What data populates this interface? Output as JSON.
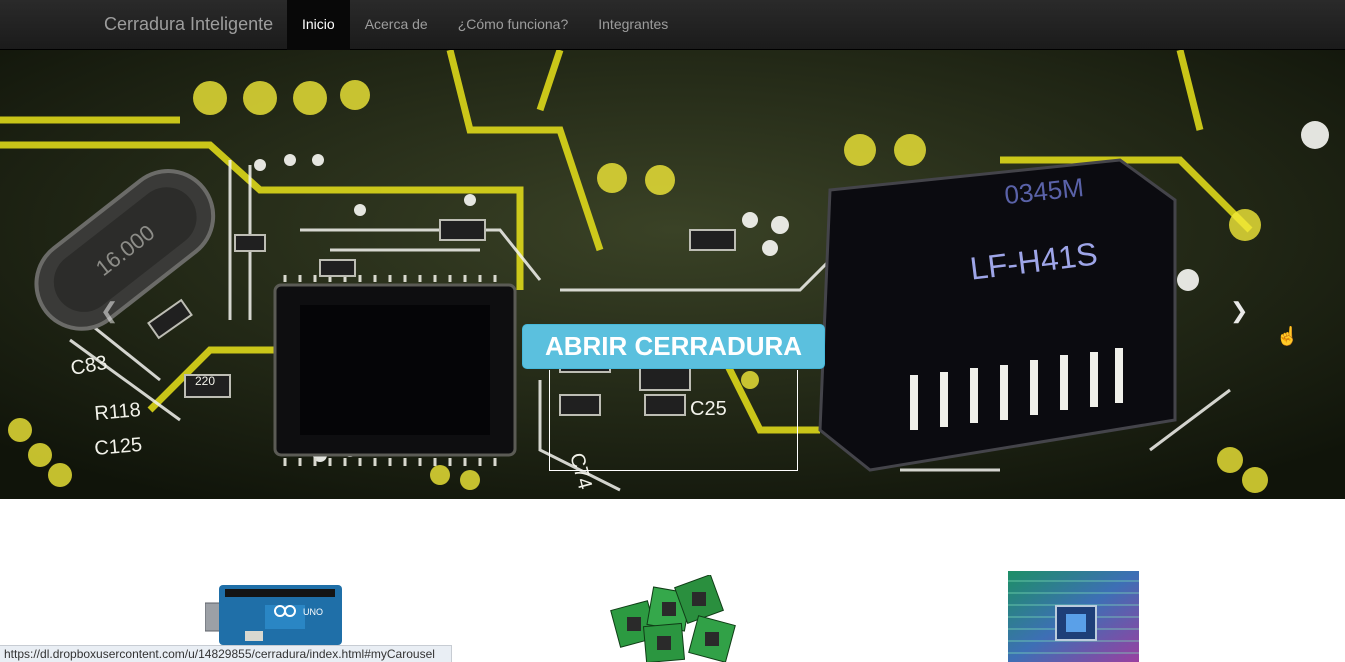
{
  "navbar": {
    "brand": "Cerradura Inteligente",
    "items": [
      {
        "label": "Inicio",
        "active": true
      },
      {
        "label": "Acerca de",
        "active": false
      },
      {
        "label": "¿Cómo funciona?",
        "active": false
      },
      {
        "label": "Integrantes",
        "active": false
      }
    ]
  },
  "carousel": {
    "button_label": "ABRIR CERRADURA",
    "prev_icon": "chevron-left-icon",
    "next_icon": "chevron-right-icon",
    "indicator_count": 3,
    "active_indicator": 3,
    "chip_labels": {
      "crystal": "16.000",
      "module": "LF-H41S",
      "module_code": "0345M",
      "c83": "C83",
      "c25": "C25",
      "c74": "C74",
      "r118": "R118",
      "c125": "C125",
      "r220": "220"
    }
  },
  "thumbnails": [
    {
      "name": "arduino-uno-image",
      "label": "UNO"
    },
    {
      "name": "cpu-chips-image"
    },
    {
      "name": "circuit-binary-image"
    }
  ],
  "statusbar": {
    "url": "https://dl.dropboxusercontent.com/u/14829855/cerradura/index.html#myCarousel"
  },
  "colors": {
    "navbar_bg": "#222222",
    "button": "#5bc0de",
    "trace_yellow": "#e8e21a"
  }
}
